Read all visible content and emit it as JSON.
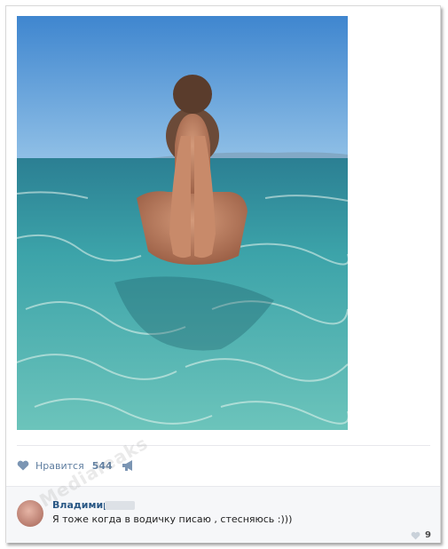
{
  "post": {
    "likes_label": "Нравится",
    "likes_count": "544",
    "photo_icon": "photo-image"
  },
  "comment": {
    "author": "Владимир",
    "text": "Я тоже когда в водичку писаю , стесняюсь :)))",
    "likes": "9"
  },
  "watermark": "Medialeaks",
  "icons": {
    "like": "heart-icon",
    "share": "megaphone-icon",
    "comment_like": "heart-icon"
  },
  "colors": {
    "link": "#2a5885",
    "meta": "#5f7ea0",
    "sky": "#5a9ad6",
    "sea": "#3ea3a6"
  }
}
